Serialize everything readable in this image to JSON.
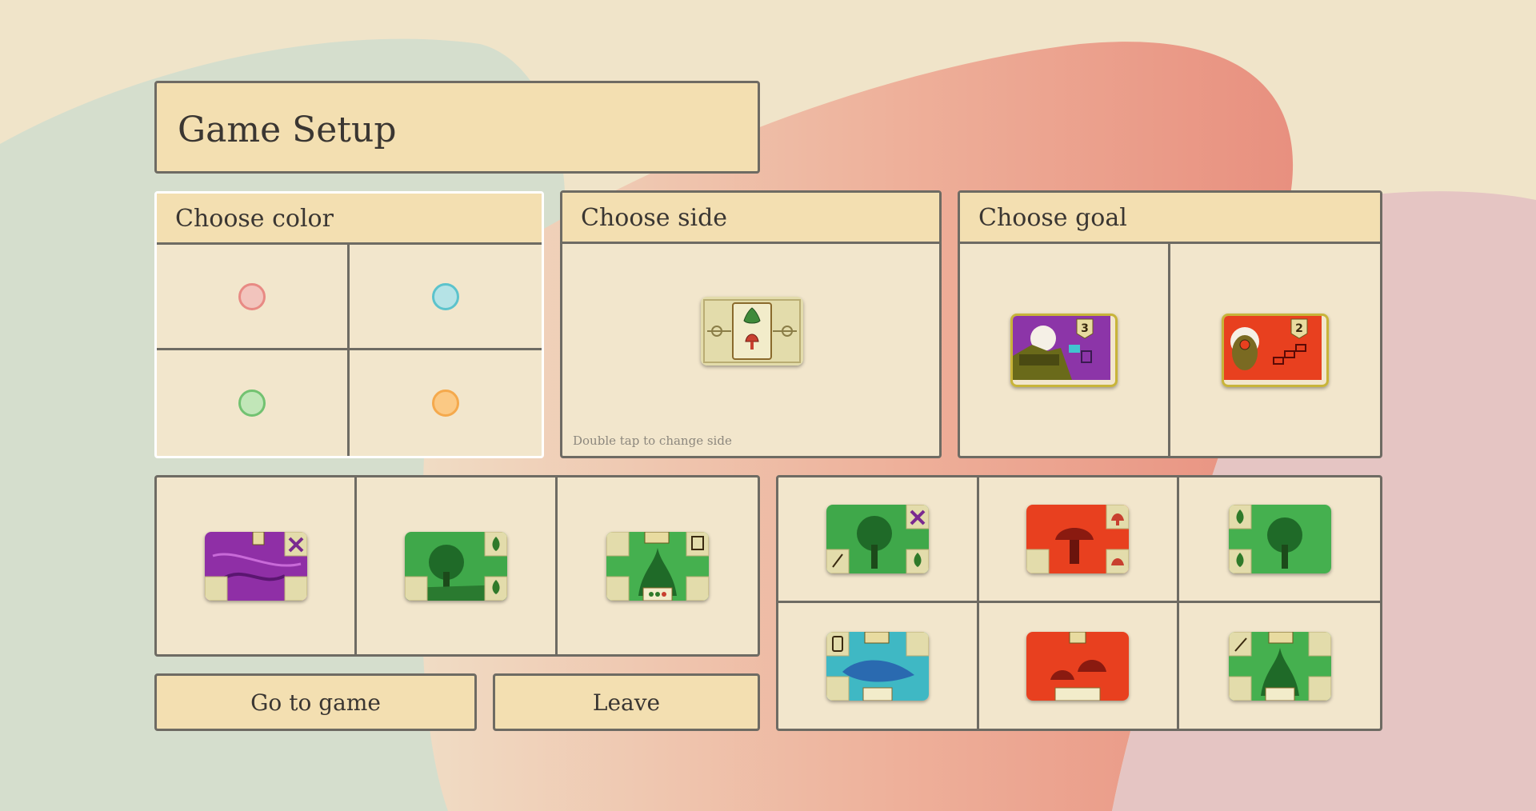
{
  "header": {
    "title": "Game Setup"
  },
  "color_panel": {
    "title": "Choose color",
    "options": [
      {
        "name": "pink",
        "fill": "#f2c4bd",
        "stroke": "#e88a84"
      },
      {
        "name": "cyan",
        "fill": "#b5e3e6",
        "stroke": "#5cc3cc"
      },
      {
        "name": "green",
        "fill": "#c1e6b8",
        "stroke": "#72c271"
      },
      {
        "name": "orange",
        "fill": "#fbc984",
        "stroke": "#f5a94c"
      }
    ]
  },
  "side_panel": {
    "title": "Choose side",
    "hint": "Double tap to change side"
  },
  "goal_panel": {
    "title": "Choose goal",
    "goals": [
      {
        "color": "purple",
        "points": "3"
      },
      {
        "color": "red",
        "points": "2"
      }
    ]
  },
  "hand": [
    {
      "color": "purple",
      "corner_icon": "butterfly-icon"
    },
    {
      "color": "green",
      "corner_icon": "leaf-icon"
    },
    {
      "color": "green",
      "corner_icon": "scroll-icon"
    }
  ],
  "market": [
    {
      "color": "green",
      "corner_icon": "butterfly-icon"
    },
    {
      "color": "red",
      "corner_icon": "mushroom-icon"
    },
    {
      "color": "green",
      "corner_icon": "leaf-icon"
    },
    {
      "color": "cyan",
      "corner_icon": "jar-icon"
    },
    {
      "color": "red",
      "corner_icon": "points-icon"
    },
    {
      "color": "green",
      "corner_icon": "feather-icon"
    }
  ],
  "buttons": {
    "go": "Go to game",
    "leave": "Leave"
  }
}
